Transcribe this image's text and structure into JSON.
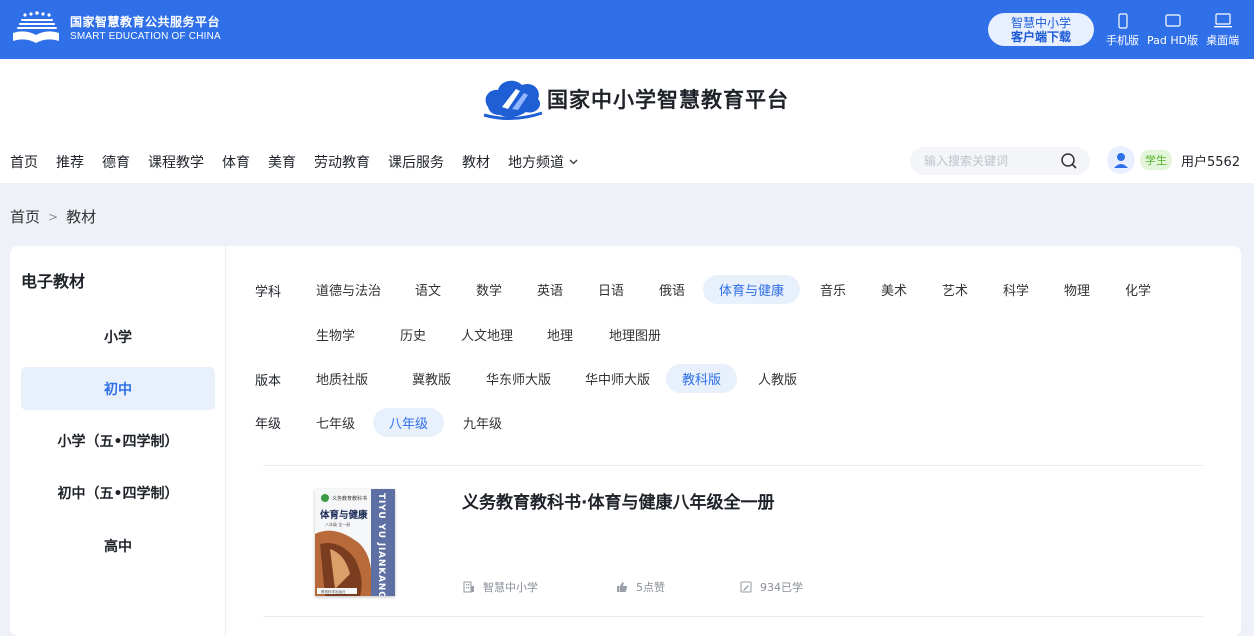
{
  "topbar": {
    "brand_cn": "国家智慧教育公共服务平台",
    "brand_en": "SMART EDUCATION OF CHINA",
    "client_btn_line1": "智慧中小学",
    "client_btn_line2": "客户端下载",
    "devices": [
      {
        "label": "手机版",
        "icon": "phone-icon"
      },
      {
        "label": "Pad HD版",
        "icon": "tablet-icon"
      },
      {
        "label": "桌面端",
        "icon": "desktop-icon"
      }
    ]
  },
  "header": {
    "logo_title": "国家中小学智慧教育平台",
    "nav": [
      "首页",
      "推荐",
      "德育",
      "课程教学",
      "体育",
      "美育",
      "劳动教育",
      "课后服务",
      "教材",
      "地方频道"
    ],
    "search_placeholder": "输入搜索关键词",
    "role_badge": "学生",
    "username": "用户5562"
  },
  "breadcrumb": {
    "home": "首页",
    "separator": ">",
    "current": "教材"
  },
  "sidebar": {
    "title": "电子教材",
    "items": [
      "小学",
      "初中",
      "小学（五•四学制）",
      "初中（五•四学制）",
      "高中"
    ],
    "active_index": 1
  },
  "filters": {
    "subject_label": "学科",
    "subjects_row1": [
      "道德与法治",
      "语文",
      "数学",
      "英语",
      "日语",
      "俄语",
      "体育与健康",
      "音乐",
      "美术",
      "艺术",
      "科学",
      "物理",
      "化学"
    ],
    "subjects_row2": [
      "生物学",
      "历史",
      "人文地理",
      "地理",
      "地理图册"
    ],
    "subject_active": "体育与健康",
    "edition_label": "版本",
    "editions": [
      "地质社版",
      "冀教版",
      "华东师大版",
      "华中师大版",
      "教科版",
      "人教版"
    ],
    "edition_active": "教科版",
    "grade_label": "年级",
    "grades": [
      "七年级",
      "八年级",
      "九年级"
    ],
    "grade_active": "八年级"
  },
  "book": {
    "title": "义务教育教科书·体育与健康八年级全一册",
    "source": "智慧中小学",
    "likes": "5点赞",
    "learners": "934已学",
    "cover": {
      "series": "义务教育教科书",
      "title": "体育与健康",
      "grade": "八年级 全一册",
      "vertical_text": "TIYU YU JIANKANG",
      "publisher": "教育科学出版社"
    }
  },
  "colors": {
    "brand_blue": "#2f6fe8",
    "active_bg": "#e8f0fc",
    "badge_green": "#56b22a"
  }
}
